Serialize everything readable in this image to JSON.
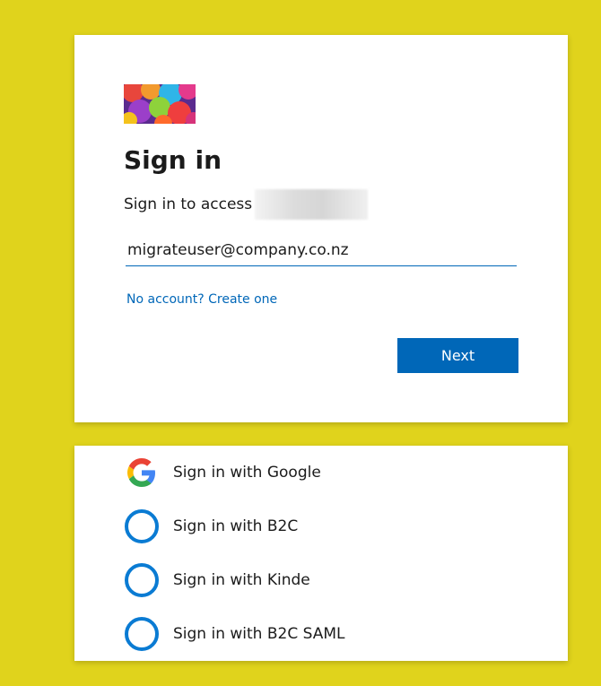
{
  "signin": {
    "title": "Sign in",
    "subtitle": "Sign in to access",
    "email_value": "migrateuser@company.co.nz",
    "create_link": "No account? Create one",
    "next_label": "Next"
  },
  "providers": [
    {
      "label": "Sign in with Google",
      "icon": "google-icon"
    },
    {
      "label": "Sign in with B2C",
      "icon": "circle-icon"
    },
    {
      "label": "Sign in with Kinde",
      "icon": "circle-icon"
    },
    {
      "label": "Sign in with B2C SAML",
      "icon": "circle-icon"
    }
  ],
  "colors": {
    "background": "#e0d31c",
    "accent": "#0067b8",
    "provider_ring": "#0a7bd3"
  }
}
